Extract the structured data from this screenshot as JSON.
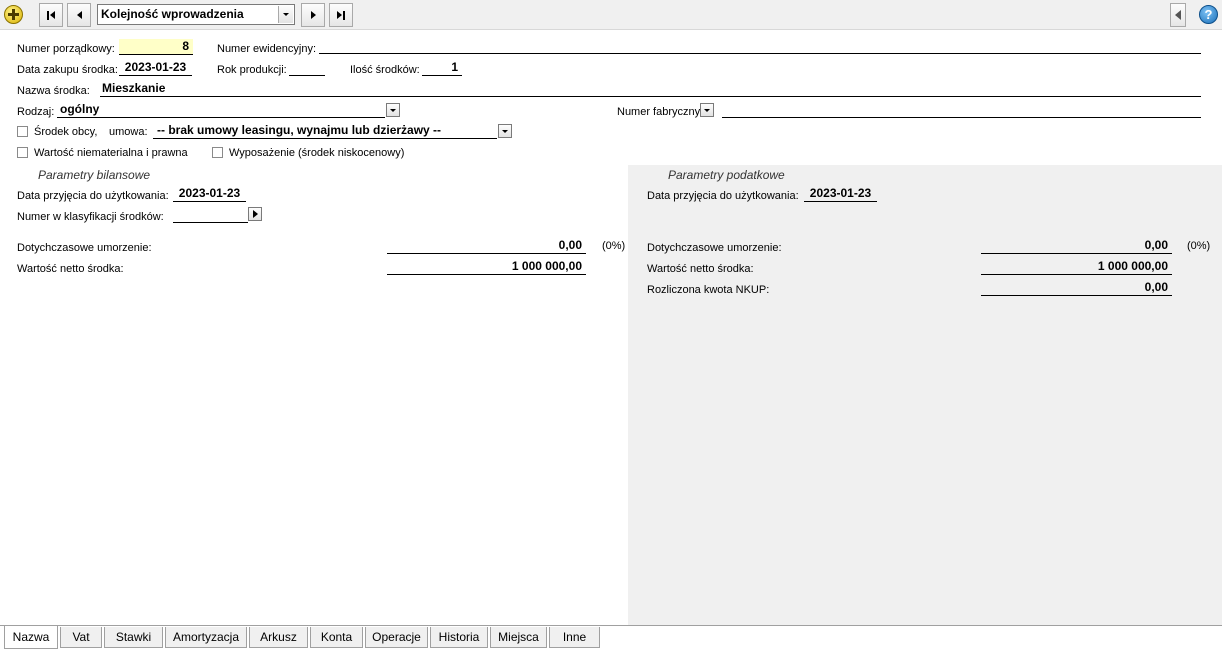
{
  "toolbar": {
    "sort_combo_value": "Kolejność wprowadzenia"
  },
  "form": {
    "numer_porzadkowy_label": "Numer porządkowy:",
    "numer_porzadkowy_value": "8",
    "numer_ewidencyjny_label": "Numer ewidencyjny:",
    "numer_ewidencyjny_value": "",
    "data_zakupu_label": "Data zakupu środka:",
    "data_zakupu_value": "2023-01-23",
    "rok_produkcji_label": "Rok produkcji:",
    "rok_produkcji_value": "",
    "ilosc_srodkow_label": "Ilość środków:",
    "ilosc_srodkow_value": "1",
    "nazwa_srodka_label": "Nazwa środka:",
    "nazwa_srodka_value": "Mieszkanie",
    "rodzaj_label": "Rodzaj:",
    "rodzaj_value": "ogólny",
    "numer_fabryczny_label": "Numer fabryczny",
    "numer_fabryczny_value": "",
    "srodek_obcy_label": "Środek obcy,",
    "umowa_label": "umowa:",
    "umowa_value": "-- brak umowy leasingu, wynajmu lub dzierżawy --",
    "wartosc_niematerialna_label": "Wartość niematerialna i prawna",
    "wyposazenie_label": "Wyposażenie (środek niskocenowy)"
  },
  "bilansowe": {
    "title": "Parametry bilansowe",
    "data_przyjecia_label": "Data przyjęcia do użytkowania:",
    "data_przyjecia_value": "2023-01-23",
    "klasyfikacja_label": "Numer w klasyfikacji środków:",
    "klasyfikacja_value": "",
    "umorzenie_label": "Dotychczasowe umorzenie:",
    "umorzenie_value": "0,00",
    "umorzenie_pct": "(0%)",
    "netto_label": "Wartość netto środka:",
    "netto_value": "1 000 000,00"
  },
  "podatkowe": {
    "title": "Parametry podatkowe",
    "data_przyjecia_label": "Data przyjęcia do użytkowania:",
    "data_przyjecia_value": "2023-01-23",
    "umorzenie_label": "Dotychczasowe umorzenie:",
    "umorzenie_value": "0,00",
    "umorzenie_pct": "(0%)",
    "netto_label": "Wartość netto środka:",
    "netto_value": "1 000 000,00",
    "nkup_label": "Rozliczona kwota NKUP:",
    "nkup_value": "0,00"
  },
  "tabs": [
    {
      "label": "Nazwa"
    },
    {
      "label": "Vat"
    },
    {
      "label": "Stawki"
    },
    {
      "label": "Amortyzacja"
    },
    {
      "label": "Arkusz"
    },
    {
      "label": "Konta"
    },
    {
      "label": "Operacje"
    },
    {
      "label": "Historia"
    },
    {
      "label": "Miejsca"
    },
    {
      "label": "Inne"
    }
  ],
  "colors": {
    "accent_yellow": "#ffffc8",
    "panel_gray": "#f0f0f0",
    "add_icon": "#e8c21a",
    "help_icon": "#2a7fc4"
  }
}
